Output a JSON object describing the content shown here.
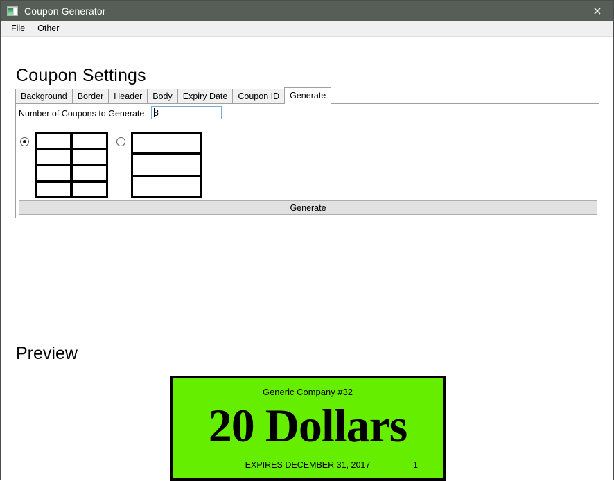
{
  "window": {
    "title": "Coupon Generator",
    "icon": "app-window-icon",
    "close_label": "×"
  },
  "menubar": {
    "items": [
      {
        "label": "File"
      },
      {
        "label": "Other"
      }
    ]
  },
  "settings": {
    "heading": "Coupon Settings",
    "tabs": [
      {
        "label": "Background",
        "selected": false
      },
      {
        "label": "Border",
        "selected": false
      },
      {
        "label": "Header",
        "selected": false
      },
      {
        "label": "Body",
        "selected": false
      },
      {
        "label": "Expiry Date",
        "selected": false
      },
      {
        "label": "Coupon ID",
        "selected": false
      },
      {
        "label": "Generate",
        "selected": true
      }
    ],
    "generate_tab": {
      "count_label": "Number of Coupons to Generate",
      "count_value": "8",
      "count_placeholder": "",
      "layouts": [
        {
          "name": "grid-2x4",
          "columns": 2,
          "rows": 4,
          "selected": true
        },
        {
          "name": "grid-1x3",
          "columns": 1,
          "rows": 3,
          "selected": false
        }
      ],
      "generate_button": "Generate"
    }
  },
  "preview": {
    "heading": "Preview",
    "coupon": {
      "header": "Generic Company #32",
      "amount": "20 Dollars",
      "expiry": "EXPIRES DECEMBER 31, 2017",
      "number": "1",
      "background_color": "#66ee00",
      "border_color": "#000000",
      "text_color": "#000000"
    }
  },
  "colors": {
    "titlebar": "#555f58",
    "menubar": "#f0f0f0",
    "panel_border": "#a0a0a0",
    "button_face": "#e1e1e1",
    "input_border": "#7aa9d4"
  }
}
